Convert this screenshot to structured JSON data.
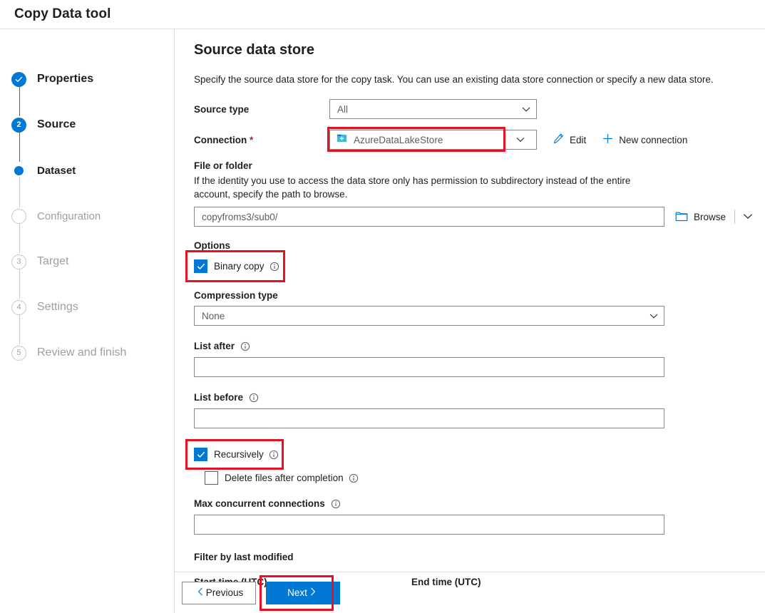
{
  "window": {
    "title": "Copy Data tool"
  },
  "wizard": {
    "steps": [
      {
        "label": "Properties",
        "state": "completed",
        "marker": "check"
      },
      {
        "label": "Source",
        "state": "current",
        "marker": "2"
      },
      {
        "label": "Dataset",
        "state": "active-sub",
        "marker": "dot"
      },
      {
        "label": "Configuration",
        "state": "pending-sub",
        "marker": "circle"
      },
      {
        "label": "Target",
        "state": "pending",
        "marker": "3"
      },
      {
        "label": "Settings",
        "state": "pending",
        "marker": "4"
      },
      {
        "label": "Review and finish",
        "state": "pending",
        "marker": "5"
      }
    ]
  },
  "page": {
    "title": "Source data store",
    "description": "Specify the source data store for the copy task. You can use an existing data store connection or specify a new data store."
  },
  "form": {
    "source_type": {
      "label": "Source type",
      "value": "All",
      "options": [
        "All"
      ]
    },
    "connection": {
      "label": "Connection",
      "required_marker": "*",
      "value": "AzureDataLakeStore",
      "icon": "azure-data-lake-icon",
      "edit_label": "Edit",
      "new_connection_label": "New connection"
    },
    "file_or_folder": {
      "label": "File or folder",
      "help": "If the identity you use to access the data store only has permission to subdirectory instead of the entire account, specify the path to browse.",
      "value": "copyfroms3/sub0/",
      "browse_label": "Browse"
    },
    "options": {
      "label": "Options",
      "binary_copy": {
        "label": "Binary copy",
        "checked": true,
        "highlighted": true
      }
    },
    "compression_type": {
      "label": "Compression type",
      "value": "None",
      "options": [
        "None"
      ]
    },
    "list_after": {
      "label": "List after",
      "value": ""
    },
    "list_before": {
      "label": "List before",
      "value": ""
    },
    "recursively": {
      "label": "Recursively",
      "checked": true,
      "highlighted": true
    },
    "delete_files": {
      "label": "Delete files after completion",
      "checked": false
    },
    "max_concurrent_connections": {
      "label": "Max concurrent connections",
      "value": ""
    },
    "filter_by_last_modified": {
      "label": "Filter by last modified",
      "start_label": "Start time (UTC)",
      "end_label": "End time (UTC)"
    }
  },
  "footer": {
    "previous_label": "Previous",
    "next_label": "Next",
    "next_highlighted": true
  },
  "colors": {
    "accent": "#0078d4",
    "highlight": "#e81123",
    "required": "#a4262c",
    "muted_text": "#a19f9d",
    "border": "#8a8886"
  }
}
